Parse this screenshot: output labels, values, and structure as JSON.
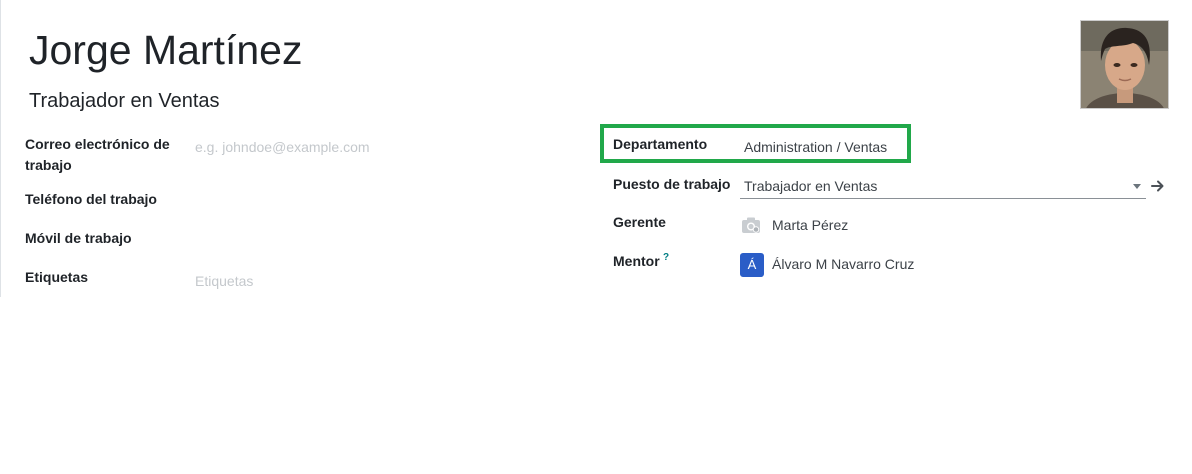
{
  "employee": {
    "name": "Jorge Martínez",
    "job_title": "Trabajador en Ventas"
  },
  "left_fields": {
    "work_email_label_line1": "Correo electrónico de",
    "work_email_label_line2": "trabajo",
    "work_email_placeholder": "e.g. johndoe@example.com",
    "work_phone_label": "Teléfono del trabajo",
    "mobile_label": "Móvil de trabajo",
    "tags_label": "Etiquetas",
    "tags_placeholder": "Etiquetas"
  },
  "right_fields": {
    "department_label": "Departamento",
    "department_value": "Administration / Ventas",
    "job_position_label": "Puesto de trabajo",
    "job_position_value": "Trabajador en Ventas",
    "manager_label": "Gerente",
    "manager_value": "Marta Pérez",
    "coach_label": "Mentor",
    "coach_help": "?",
    "coach_initial": "Á",
    "coach_value": "Álvaro M Navarro Cruz"
  },
  "icons": {
    "avatar": "employee-photo",
    "manager_avatar": "camera-icon",
    "job_dropdown": "caret-down-icon",
    "job_open": "arrow-right-icon"
  },
  "colors": {
    "highlight": "#21a84a",
    "badge": "#2a5dc7",
    "help": "#017e84"
  }
}
